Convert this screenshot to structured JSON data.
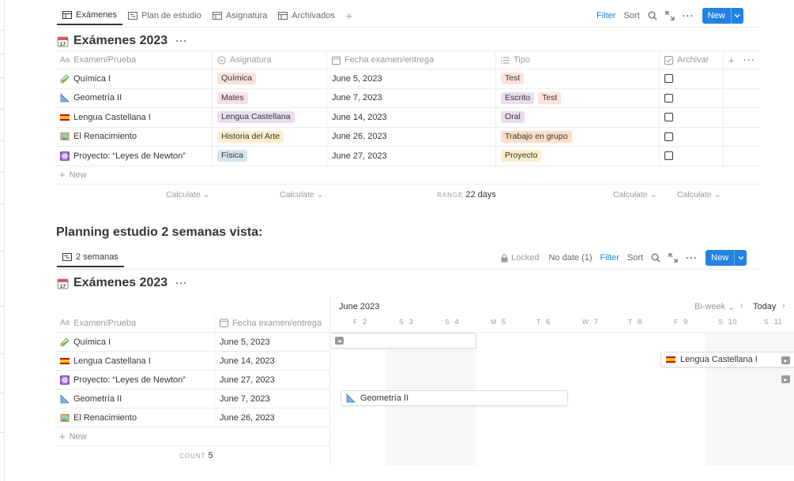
{
  "tabs": [
    {
      "label": "Exámenes",
      "icon": "table-icon",
      "active": true
    },
    {
      "label": "Plan de estudio",
      "icon": "timeline-icon",
      "active": false
    },
    {
      "label": "Asignatura",
      "icon": "table-icon",
      "active": false
    },
    {
      "label": "Archivados",
      "icon": "table-icon",
      "active": false
    }
  ],
  "toolbar": {
    "filter": "Filter",
    "sort": "Sort",
    "new": "New"
  },
  "db1": {
    "title": "Exámenes 2023",
    "columns": [
      "Examen/Prueba",
      "Asignatura",
      "Fecha examen/entrega",
      "Tipo",
      "Archivar"
    ],
    "rows": [
      {
        "name": "Química I",
        "emoji": "test-tube-icon",
        "subject": "Química",
        "subject_color": "brown",
        "date": "June 5, 2023",
        "tipo": [
          {
            "label": "Test",
            "color": "red"
          }
        ]
      },
      {
        "name": "Geometría II",
        "emoji": "triangular-ruler-icon",
        "subject": "Mates",
        "subject_color": "pink",
        "date": "June 7, 2023",
        "tipo": [
          {
            "label": "Escrito",
            "color": "purple"
          },
          {
            "label": "Test",
            "color": "red"
          }
        ]
      },
      {
        "name": "Lengua Castellana I",
        "emoji": "spain-flag-icon",
        "subject": "Lengua Castellana",
        "subject_color": "purple",
        "date": "June 14, 2023",
        "tipo": [
          {
            "label": "Oral",
            "color": "purple"
          }
        ]
      },
      {
        "name": "El Renacimiento",
        "emoji": "framed-picture-icon",
        "subject": "Historia del Arte",
        "subject_color": "yellow",
        "date": "June 26, 2023",
        "tipo": [
          {
            "label": "Trabajo en grupo",
            "color": "orange"
          }
        ]
      },
      {
        "name": "Proyecto: “Leyes de Newton”",
        "emoji": "atom-icon",
        "subject": "Física",
        "subject_color": "blue",
        "date": "June 27, 2023",
        "tipo": [
          {
            "label": "Proyecto",
            "color": "yellow"
          }
        ]
      }
    ],
    "new_row": "New",
    "calc": {
      "c2": "Calculate",
      "c3": "Calculate",
      "range_label": "RANGE",
      "range_value": "22 days",
      "c5": "Calculate",
      "c6": "Calculate"
    }
  },
  "section_heading": "Planning estudio 2 semanas vista:",
  "tab2": {
    "label": "2 semanas",
    "icon": "timeline-icon"
  },
  "toolbar2": {
    "locked": "Locked",
    "no_date": "No date (1)",
    "filter": "Filter",
    "sort": "Sort",
    "new": "New"
  },
  "db2": {
    "title": "Exámenes 2023",
    "columns": [
      "Examen/Prueba",
      "Fecha examen/entrega"
    ],
    "rows": [
      {
        "name": "Química I",
        "emoji": "test-tube-icon",
        "date": "June 5, 2023"
      },
      {
        "name": "Lengua Castellana I",
        "emoji": "spain-flag-icon",
        "date": "June 14, 2023"
      },
      {
        "name": "Proyecto: “Leyes de Newton”",
        "emoji": "atom-icon",
        "date": "June 27, 2023"
      },
      {
        "name": "Geometría II",
        "emoji": "triangular-ruler-icon",
        "date": "June 7, 2023"
      },
      {
        "name": "El Renacimiento",
        "emoji": "framed-picture-icon",
        "date": "June 26, 2023"
      }
    ],
    "new_row": "New",
    "count_label": "COUNT",
    "count_value": "5"
  },
  "timeline": {
    "month": "June 2023",
    "scale": "Bi-week",
    "today": "Today",
    "days": [
      {
        "letter": "F",
        "num": "2"
      },
      {
        "letter": "S",
        "num": "3"
      },
      {
        "letter": "S",
        "num": "4"
      },
      {
        "letter": "M",
        "num": "5"
      },
      {
        "letter": "T",
        "num": "6"
      },
      {
        "letter": "W",
        "num": "7"
      },
      {
        "letter": "T",
        "num": "8"
      },
      {
        "letter": "F",
        "num": "9"
      },
      {
        "letter": "S",
        "num": "10"
      },
      {
        "letter": "S",
        "num": "11"
      }
    ],
    "bars": {
      "lengua": "Lengua Castellana I",
      "geometria": "Geometría II"
    }
  },
  "colors": {
    "accent": "#2383e2",
    "text": "#37352f",
    "muted": "#9b9a97"
  }
}
